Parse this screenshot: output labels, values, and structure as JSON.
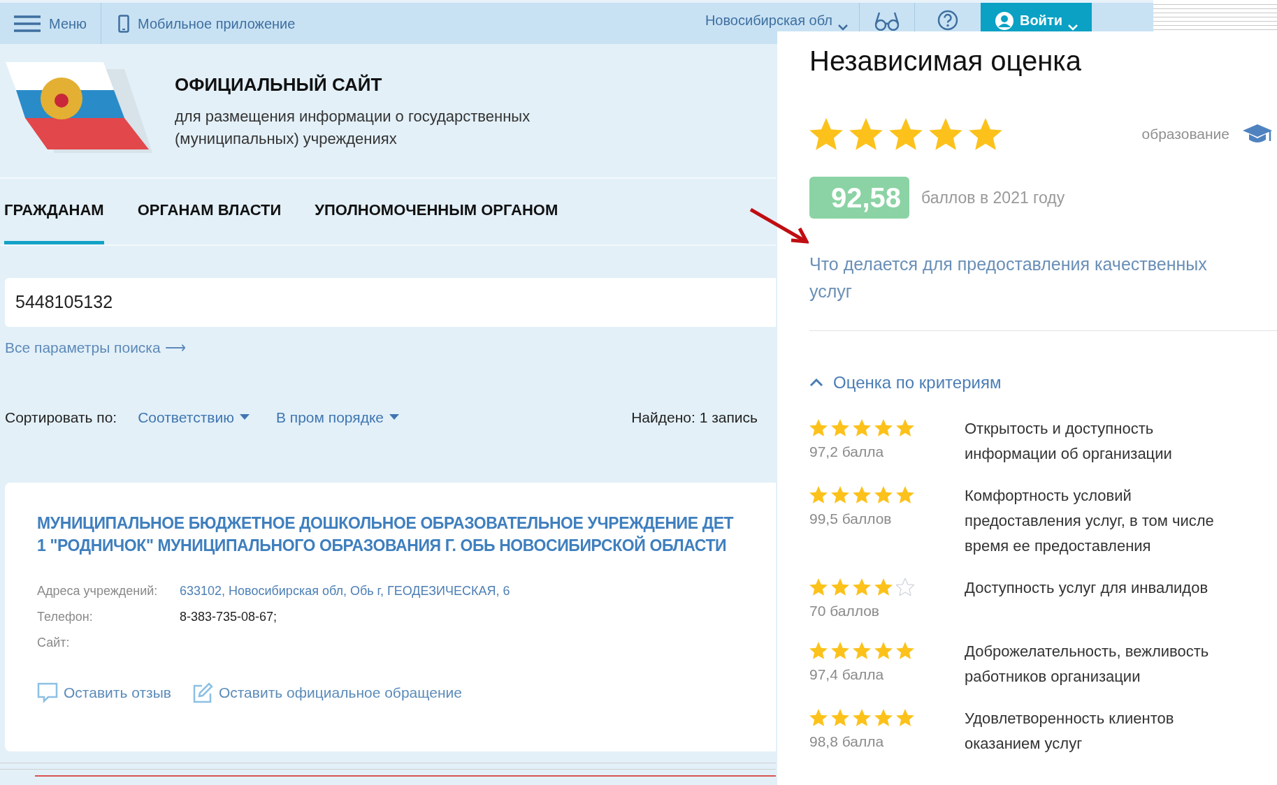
{
  "topbar": {
    "menu_label": "Меню",
    "app_label": "Мобильное приложение",
    "region": "Новосибирская обл",
    "login_label": "Войти"
  },
  "header": {
    "title": "ОФИЦИАЛЬНЫЙ САЙТ",
    "subtitle": "для размещения информации о государственных (муниципальных) учреждениях"
  },
  "tabs": [
    {
      "label": "ГРАЖДАНАМ",
      "selected": true
    },
    {
      "label": "ОРГАНАМ ВЛАСТИ",
      "selected": false
    },
    {
      "label": "УПОЛНОМОЧЕННЫМ ОРГАНОМ",
      "selected": false
    }
  ],
  "search": {
    "value": "5448105132",
    "advanced_link": "Все параметры поиска ⟶"
  },
  "sort": {
    "label": "Сортировать по:",
    "options": [
      "Соответствию",
      "В пром порядке"
    ],
    "found": "Найдено: 1 запись"
  },
  "result": {
    "title_lines": [
      "МУНИЦИПАЛЬНОЕ БЮДЖЕТНОЕ ДОШКОЛЬНОЕ ОБРАЗОВАТЕЛЬНОЕ УЧРЕЖДЕНИЕ ДЕТ",
      "1 \"РОДНИЧОК\" МУНИЦИПАЛЬНОГО ОБРАЗОВАНИЯ Г. ОБЬ НОВОСИБИРСКОЙ ОБЛАСТИ"
    ],
    "fields": [
      {
        "label": "Адреса учреждений:",
        "value": "633102, Новосибирская обл, Обь г, ГЕОДЕЗИЧЕСКАЯ, 6",
        "kind": "link"
      },
      {
        "label": "Телефон:",
        "value": "8-383-735-08-67;",
        "kind": "text"
      },
      {
        "label": "Сайт:",
        "kind": "text"
      }
    ],
    "actions": [
      {
        "label": "Оставить отзыв",
        "kind": "review"
      },
      {
        "label": "Оставить официальное обращение",
        "kind": "appeal"
      }
    ]
  },
  "panel": {
    "title": "Независимая оценка",
    "stars": 5,
    "category": "образование",
    "score": "92,58",
    "score_caption": "баллов в 2021 году",
    "link": "Что делается для предоставления качественных услуг",
    "criteria_heading": "Оценка по критериям",
    "criteria_expanded": true,
    "criteria": [
      {
        "stars": 5,
        "score": "97,2 балла",
        "name": "Открытость и доступность информации об организации"
      },
      {
        "stars": 5,
        "score": "99,5 баллов",
        "name": "Комфортность условий предоставления услуг, в том числе время ее предоставления"
      },
      {
        "stars": 4,
        "score": "70 баллов",
        "name": "Доступность услуг для инвалидов"
      },
      {
        "stars": 5,
        "score": "97,4 балла",
        "name": "Доброжелательность, вежливость работников организации"
      },
      {
        "stars": 5,
        "score": "98,8 балла",
        "name": "Удовлетворенность клиентов оказанием услуг"
      }
    ]
  }
}
